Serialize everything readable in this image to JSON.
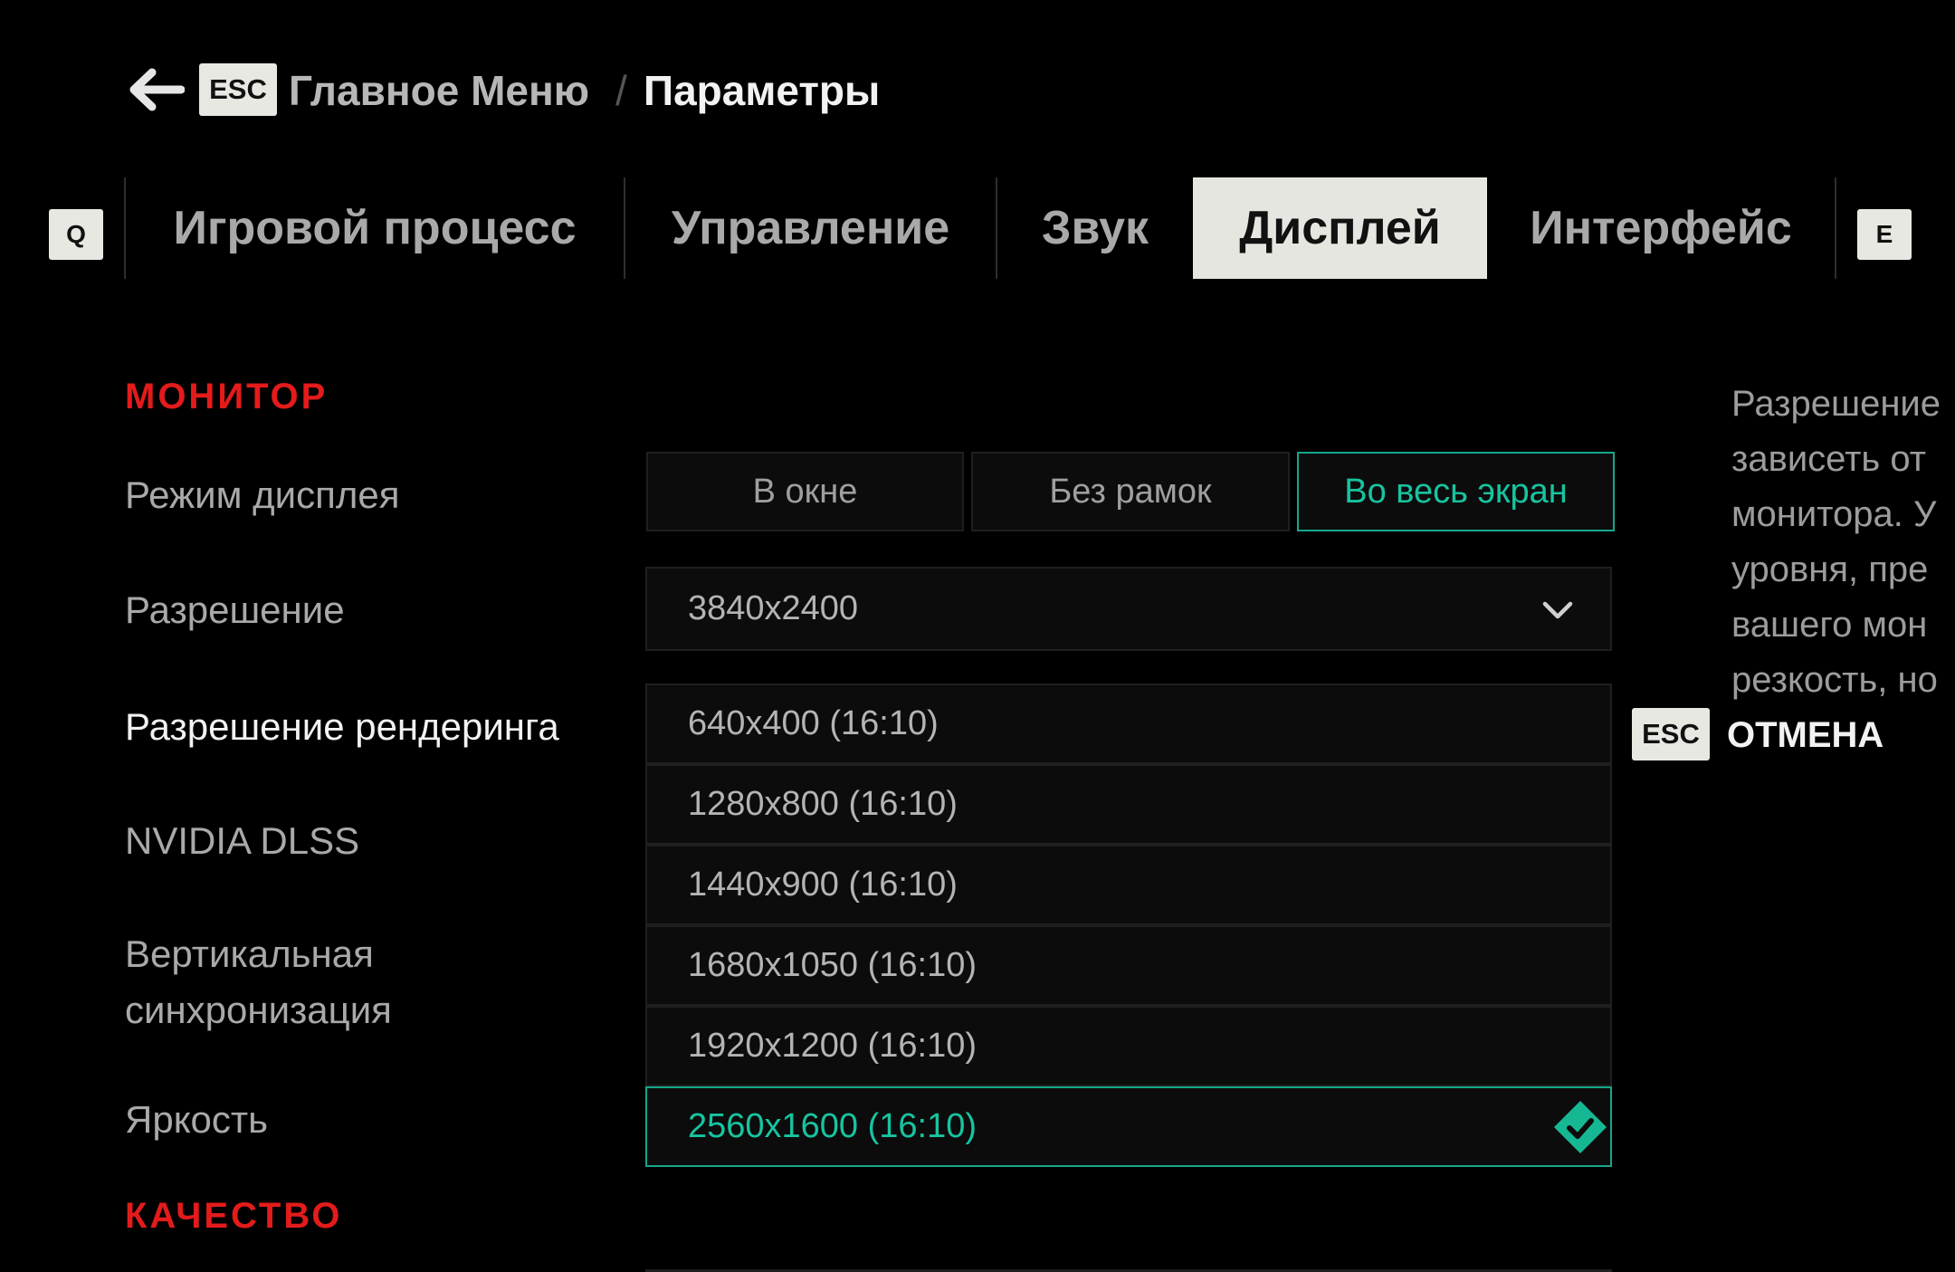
{
  "breadcrumb": {
    "back_key": "ESC",
    "parent": "Главное Меню",
    "separator": "/",
    "current": "Параметры"
  },
  "tabs": {
    "prev_key": "Q",
    "next_key": "E",
    "items": [
      {
        "label": "Игровой процесс",
        "active": false
      },
      {
        "label": "Управление",
        "active": false
      },
      {
        "label": "Звук",
        "active": false
      },
      {
        "label": "Дисплей",
        "active": true
      },
      {
        "label": "Интерфейс",
        "active": false
      }
    ]
  },
  "sections": {
    "monitor": "МОНИТОР",
    "quality": "КАЧЕСТВО"
  },
  "settings": {
    "display_mode": "Режим дисплея",
    "resolution": "Разрешение",
    "render_resolution": "Разрешение рендеринга",
    "dlss": "NVIDIA DLSS",
    "vsync": "Вертикальная синхронизация",
    "brightness": "Яркость"
  },
  "display_mode": {
    "options": [
      "В окне",
      "Без рамок",
      "Во весь экран"
    ],
    "selected": "Во весь экран"
  },
  "resolution": {
    "value": "3840x2400"
  },
  "render_resolution": {
    "options": [
      "640x400 (16:10)",
      "1280x800 (16:10)",
      "1440x900 (16:10)",
      "1680x1050 (16:10)",
      "1920x1200 (16:10)",
      "2560x1600 (16:10)"
    ],
    "selected": "2560x1600 (16:10)"
  },
  "description": {
    "lines": [
      "Разрешение",
      "зависеть от",
      "монитора. У",
      "уровня, пре",
      "вашего мон",
      "резкость, но"
    ]
  },
  "cancel": {
    "key": "ESC",
    "label": "ОТМЕНА"
  },
  "colors": {
    "accent": "#17c4a0",
    "section_title": "#e41b1b",
    "active_tab_bg": "#e6e6e1"
  }
}
